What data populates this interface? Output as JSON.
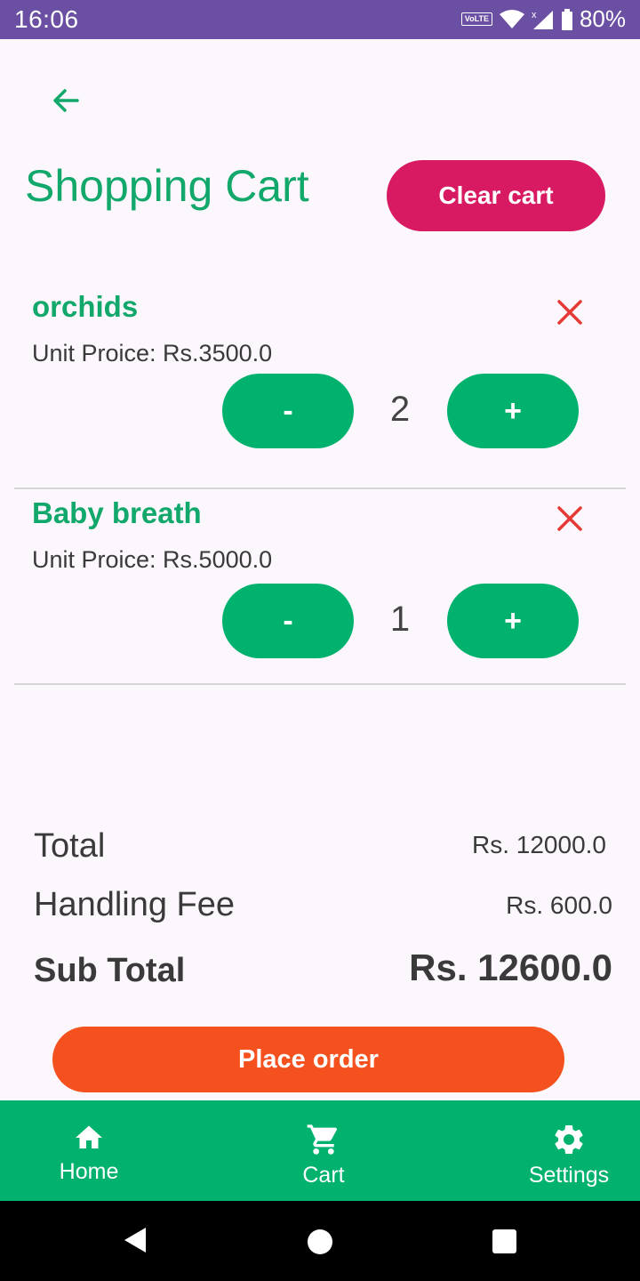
{
  "status_bar": {
    "time": "16:06",
    "volte": "VoLTE",
    "battery": "80%"
  },
  "header": {
    "title": "Shopping Cart",
    "clear_label": "Clear cart",
    "back_icon": "arrow-back-icon"
  },
  "items": [
    {
      "name": "orchids",
      "price": "Unit Proice: Rs.3500.0",
      "quantity": "2",
      "minus": "-",
      "plus": "+"
    },
    {
      "name": "Baby breath",
      "price": "Unit Proice: Rs.5000.0",
      "quantity": "1",
      "minus": "-",
      "plus": "+"
    }
  ],
  "summary": {
    "total_label": "Total",
    "total_value": "Rs. 12000.0",
    "fee_label": "Handling Fee",
    "fee_value": "Rs. 600.0",
    "sub_label": "Sub Total",
    "sub_value": "Rs. 12600.0"
  },
  "place_order_label": "Place order",
  "bottom_nav": [
    {
      "label": "Home",
      "icon": "home-icon"
    },
    {
      "label": "Cart",
      "icon": "cart-icon"
    },
    {
      "label": "Settings",
      "icon": "gear-icon"
    }
  ],
  "colors": {
    "primary": "#12A86B",
    "nav_green": "#01B16E",
    "clear_btn": "#D71A61",
    "place_btn": "#F4511E",
    "status_bar": "#6A4FA3",
    "remove_red": "#E53935"
  }
}
